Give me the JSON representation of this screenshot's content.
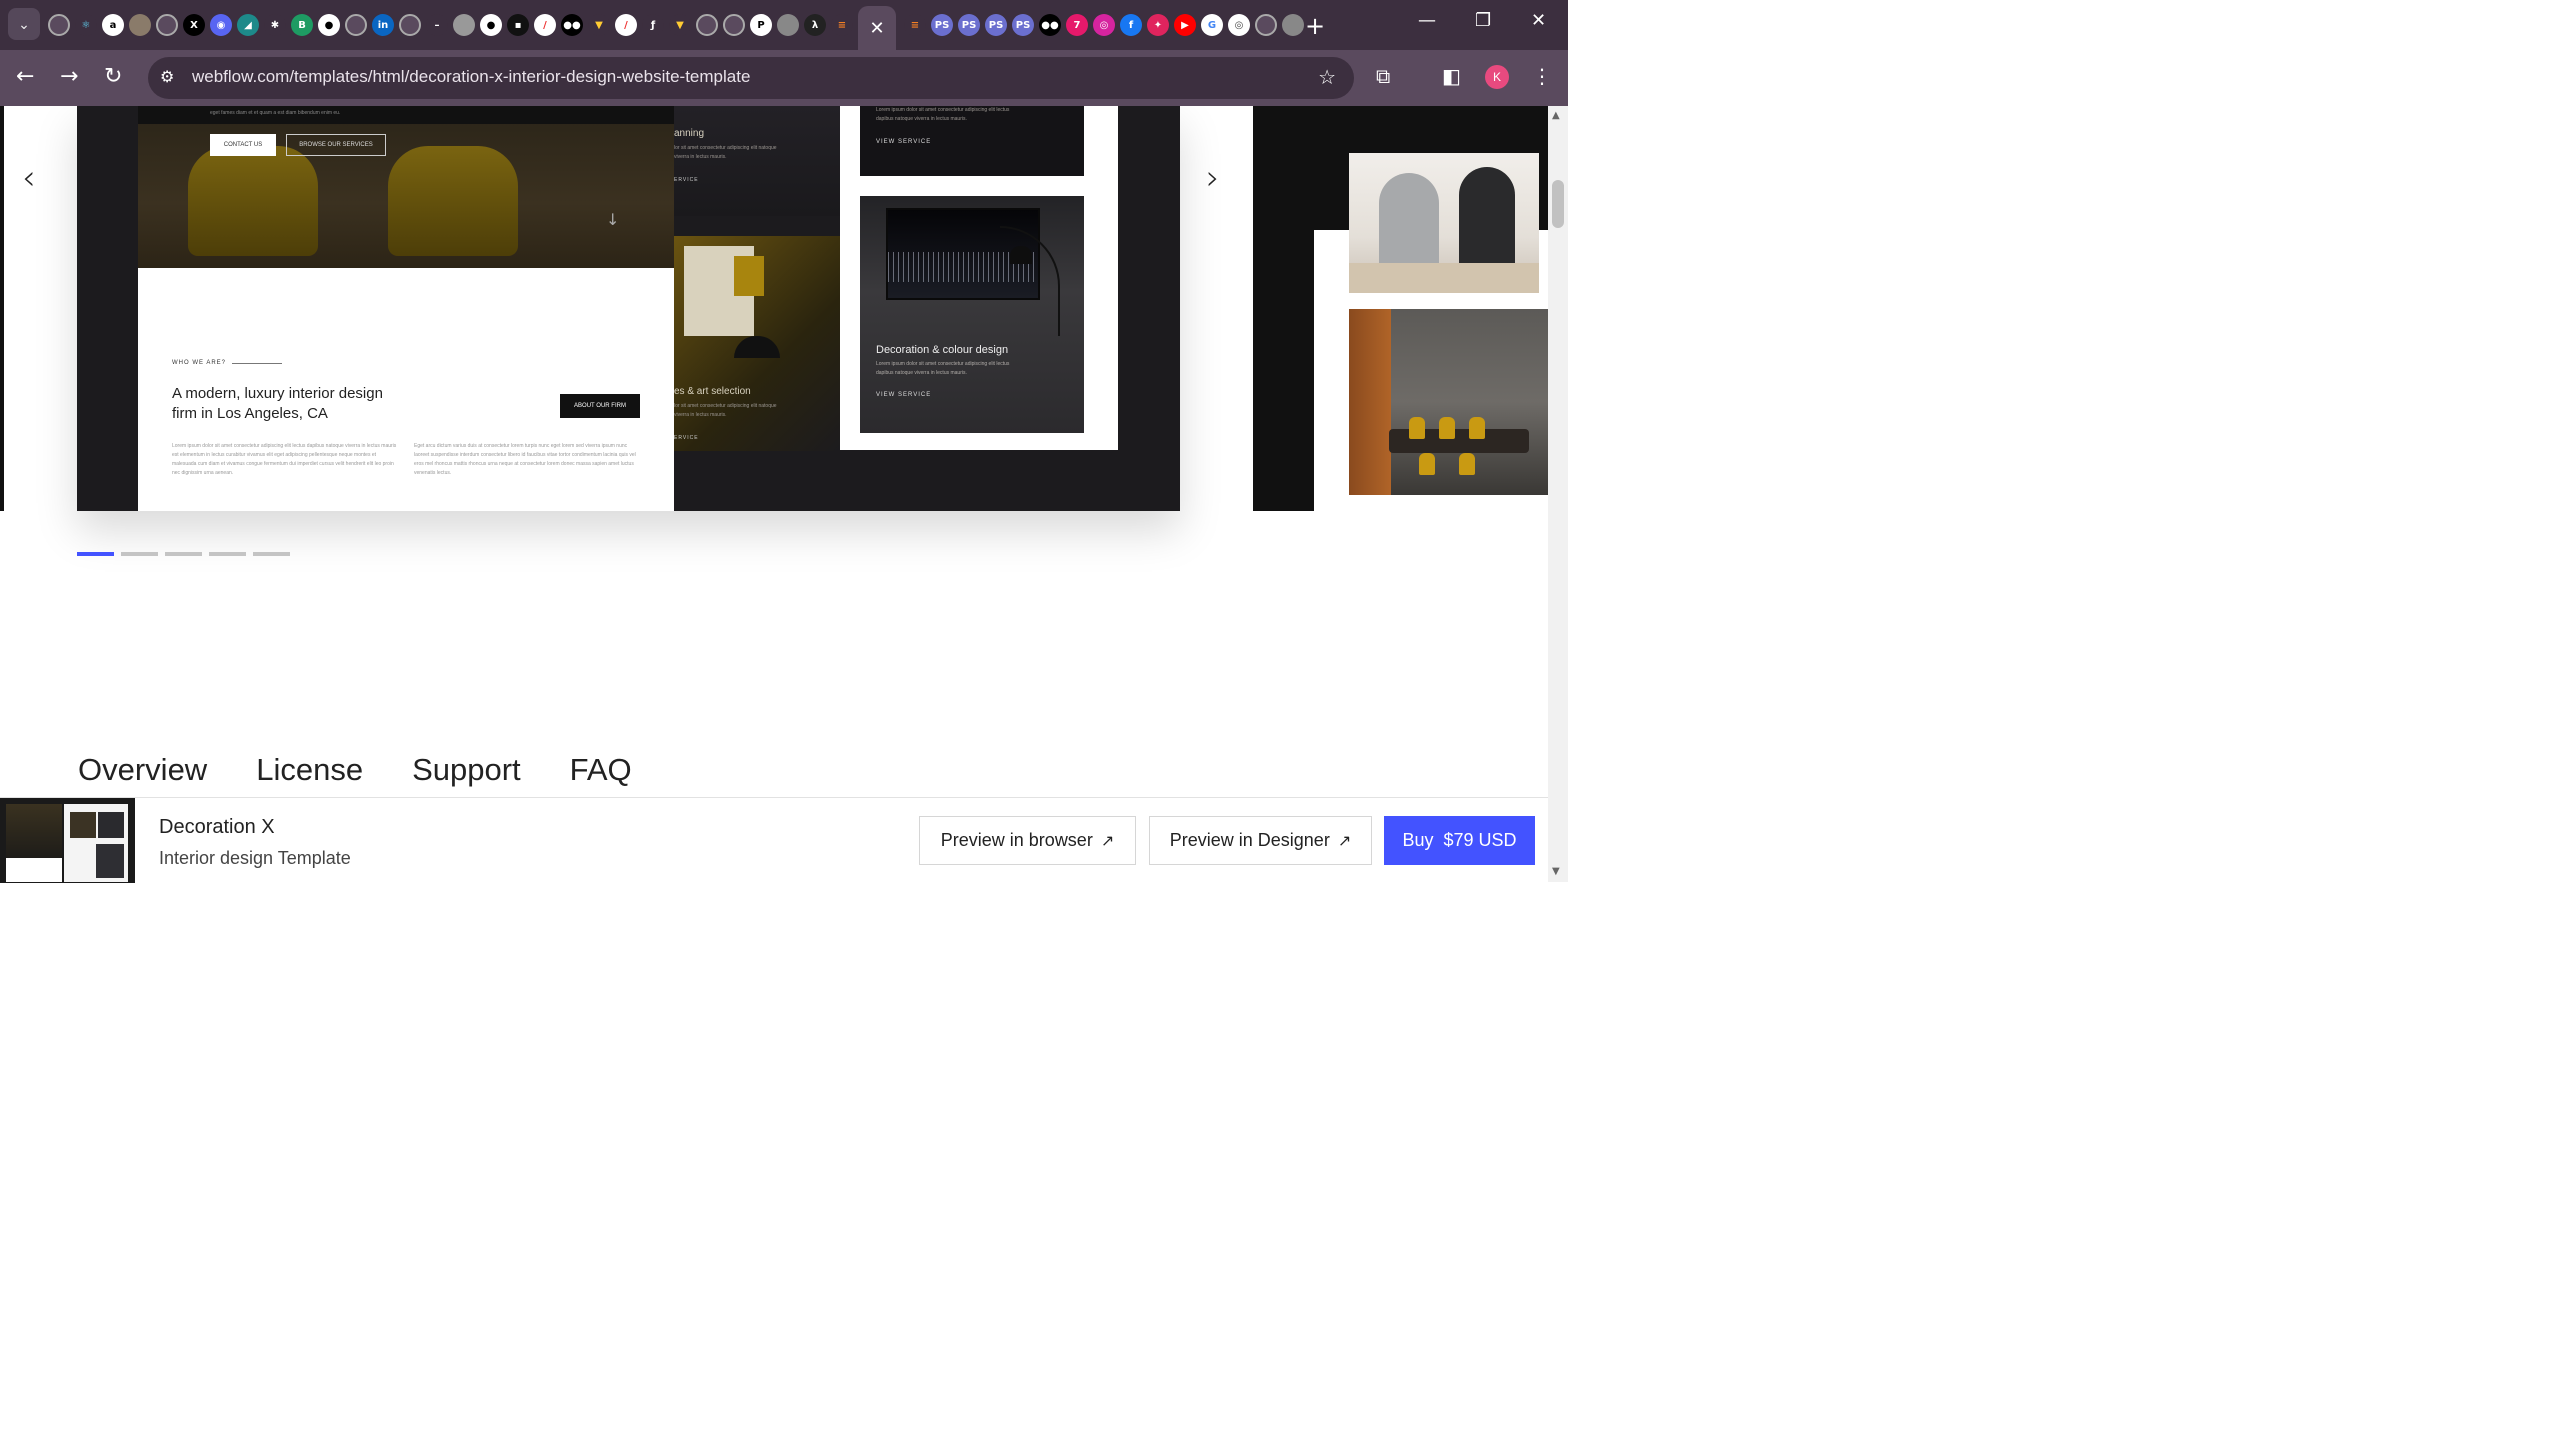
{
  "browser": {
    "url": "webflow.com/templates/html/decoration-x-interior-design-website-template",
    "profile_initial": "K",
    "active_tab_close": "✕",
    "accent_color": "#3c2f3f"
  },
  "hero_slide": {
    "contact_btn": "CONTACT US",
    "browse_btn": "BROWSE OUR SERVICES",
    "caption": "eget fames diam et et quam a est diam bibendum enim eu.",
    "who_label": "WHO WE ARE?",
    "about_title": "A modern, luxury interior design firm in Los Angeles, CA",
    "about_btn": "ABOUT OUR FIRM",
    "lorem_left": "Lorem ipsum dolor sit amet consectetur adipiscing elit lectus dapibus natoque viverra in lectus mauris est elementum in lectus curabitur vivamus elit eget adipiscing pellentesque neque montes et malesuada cum diam et vivamus congue fermentum dui imperdiet cursus velit hendrerit elit leo proin nec dignissim urna aenean.",
    "lorem_right": "Eget arcu dictum varius duis at consectetur lorem turpis nunc eget lorem sed viverra ipsum nunc laoreet suspendisse interdum consectetur libero id faucibus vitae tortor condimentum lacinia quis vel eros mel rhoncus mattis rhoncus urna neque at consectetur lorem donec massa sapien amet luctus venenatis lectus."
  },
  "services": {
    "planning_title": "anning",
    "planning_desc": "lor sit amet consectetur adipiscing elit natoque viverra in lectus mauris.",
    "planning_link": "ERVICE",
    "art_title": "es & art selection",
    "art_desc": "lor sit amet consectetur adipiscing elit natoque viverra in lectus mauris.",
    "art_link": "ERVICE",
    "top_card_desc": "Lorem ipsum dolor sit amet consectetur adipiscing elit lectus dapibus natoque viverra in lectus mauris.",
    "top_card_link": "VIEW SERVICE",
    "decor_title": "Decoration & colour design",
    "decor_desc": "Lorem ipsum dolor sit amet consectetur adipiscing elit lectus dapibus natoque viverra in lectus mauris.",
    "decor_link": "VIEW SERVICE"
  },
  "carousel": {
    "prev_icon": "‹",
    "next_icon": "›",
    "dots": 5,
    "active_dot": 0,
    "active_color": "#4353ff"
  },
  "page_tabs": [
    "Overview",
    "License",
    "Support",
    "FAQ"
  ],
  "sticky": {
    "product_name": "Decoration X",
    "product_sub": "Interior design Template",
    "preview_browser": "Preview in browser",
    "preview_designer": "Preview in Designer",
    "buy_label": "Buy  $79 USD",
    "ext_icon": "↗"
  }
}
